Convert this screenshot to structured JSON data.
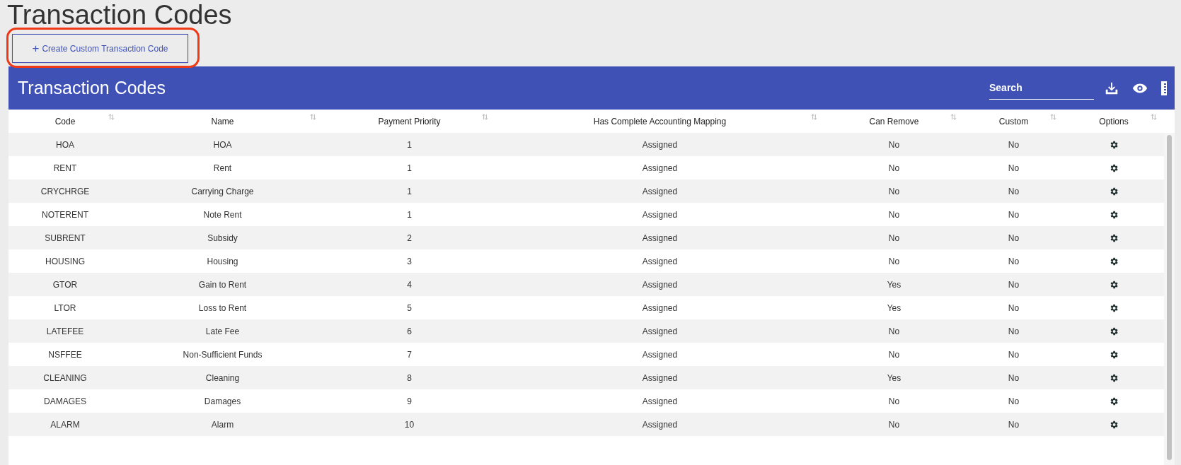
{
  "page_title": "Transaction Codes",
  "create_button": {
    "icon": "+",
    "label": "Create Custom Transaction Code",
    "highlighted": true
  },
  "table": {
    "title": "Transaction Codes",
    "search": {
      "placeholder": "Search"
    },
    "columns": [
      "Code",
      "Name",
      "Payment Priority",
      "Has Complete Accounting Mapping",
      "Can Remove",
      "Custom",
      "Options"
    ],
    "rows": [
      {
        "code": "HOA",
        "name": "HOA",
        "priority": "1",
        "mapping": "Assigned",
        "can_remove": "No",
        "custom": "No"
      },
      {
        "code": "RENT",
        "name": "Rent",
        "priority": "1",
        "mapping": "Assigned",
        "can_remove": "No",
        "custom": "No"
      },
      {
        "code": "CRYCHRGE",
        "name": "Carrying Charge",
        "priority": "1",
        "mapping": "Assigned",
        "can_remove": "No",
        "custom": "No"
      },
      {
        "code": "NOTERENT",
        "name": "Note Rent",
        "priority": "1",
        "mapping": "Assigned",
        "can_remove": "No",
        "custom": "No"
      },
      {
        "code": "SUBRENT",
        "name": "Subsidy",
        "priority": "2",
        "mapping": "Assigned",
        "can_remove": "No",
        "custom": "No"
      },
      {
        "code": "HOUSING",
        "name": "Housing",
        "priority": "3",
        "mapping": "Assigned",
        "can_remove": "No",
        "custom": "No"
      },
      {
        "code": "GTOR",
        "name": "Gain to Rent",
        "priority": "4",
        "mapping": "Assigned",
        "can_remove": "Yes",
        "custom": "No"
      },
      {
        "code": "LTOR",
        "name": "Loss to Rent",
        "priority": "5",
        "mapping": "Assigned",
        "can_remove": "Yes",
        "custom": "No"
      },
      {
        "code": "LATEFEE",
        "name": "Late Fee",
        "priority": "6",
        "mapping": "Assigned",
        "can_remove": "No",
        "custom": "No"
      },
      {
        "code": "NSFFEE",
        "name": "Non-Sufficient Funds",
        "priority": "7",
        "mapping": "Assigned",
        "can_remove": "No",
        "custom": "No"
      },
      {
        "code": "CLEANING",
        "name": "Cleaning",
        "priority": "8",
        "mapping": "Assigned",
        "can_remove": "Yes",
        "custom": "No"
      },
      {
        "code": "DAMAGES",
        "name": "Damages",
        "priority": "9",
        "mapping": "Assigned",
        "can_remove": "No",
        "custom": "No"
      },
      {
        "code": "ALARM",
        "name": "Alarm",
        "priority": "10",
        "mapping": "Assigned",
        "can_remove": "No",
        "custom": "No"
      }
    ]
  }
}
